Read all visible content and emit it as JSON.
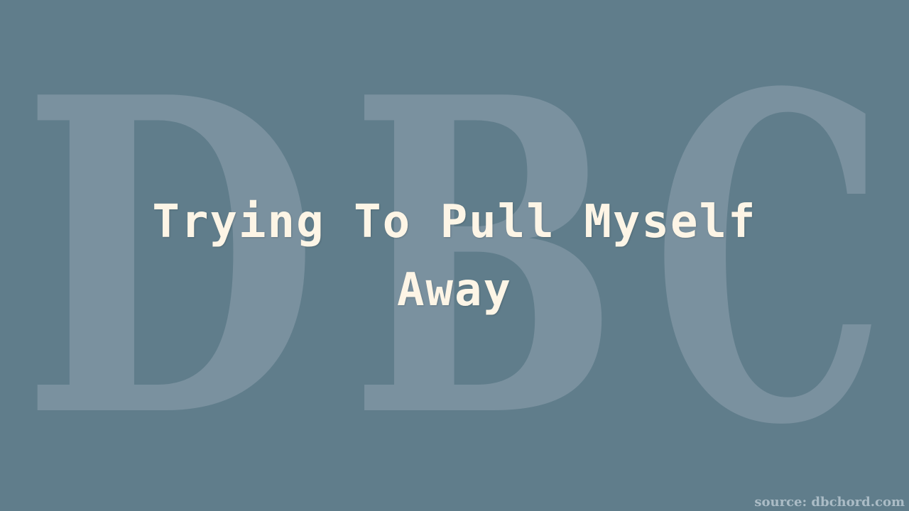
{
  "colors": {
    "background": "#607d8b",
    "title_text": "#fdf5e6",
    "watermark_letter": "#7a919f",
    "source_text": "#c4d2da"
  },
  "watermark": {
    "letters": [
      "D",
      "B",
      "C"
    ]
  },
  "title": {
    "line1": "Trying To Pull Myself",
    "line2": "Away"
  },
  "footer": {
    "source": "source: dbchord.com"
  }
}
